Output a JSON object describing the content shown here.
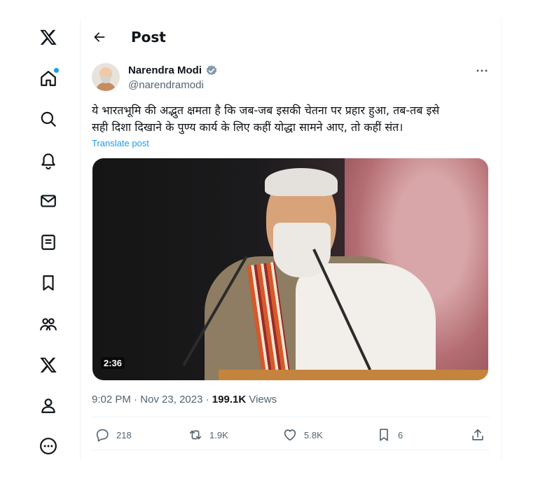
{
  "header": {
    "title": "Post"
  },
  "nav": [
    "x-logo",
    "home",
    "explore",
    "notifications",
    "messages",
    "lists",
    "bookmarks",
    "communities",
    "premium",
    "profile",
    "more"
  ],
  "post": {
    "author_name": "Narendra Modi",
    "author_handle": "@narendramodi",
    "text": "ये भारतभूमि की अद्भुत क्षमता है कि जब-जब इसकी चेतना पर प्रहार हुआ, तब-तब इसे\nसही दिशा दिखाने के पुण्य कार्य के लिए कहीं योद्धा सामने आए, तो कहीं संत।",
    "translate_label": "Translate post",
    "video_duration": "2:36",
    "time": "9:02 PM",
    "separator": "·",
    "date": "Nov 23, 2023",
    "views_count": "199.1K",
    "views_label": "Views"
  },
  "actions": {
    "replies": "218",
    "reposts": "1.9K",
    "likes": "5.8K",
    "bookmarks": "6"
  },
  "colors": {
    "accent": "#1d9bf0",
    "text": "#0f1419",
    "muted": "#536471",
    "border": "#eff3f4"
  }
}
